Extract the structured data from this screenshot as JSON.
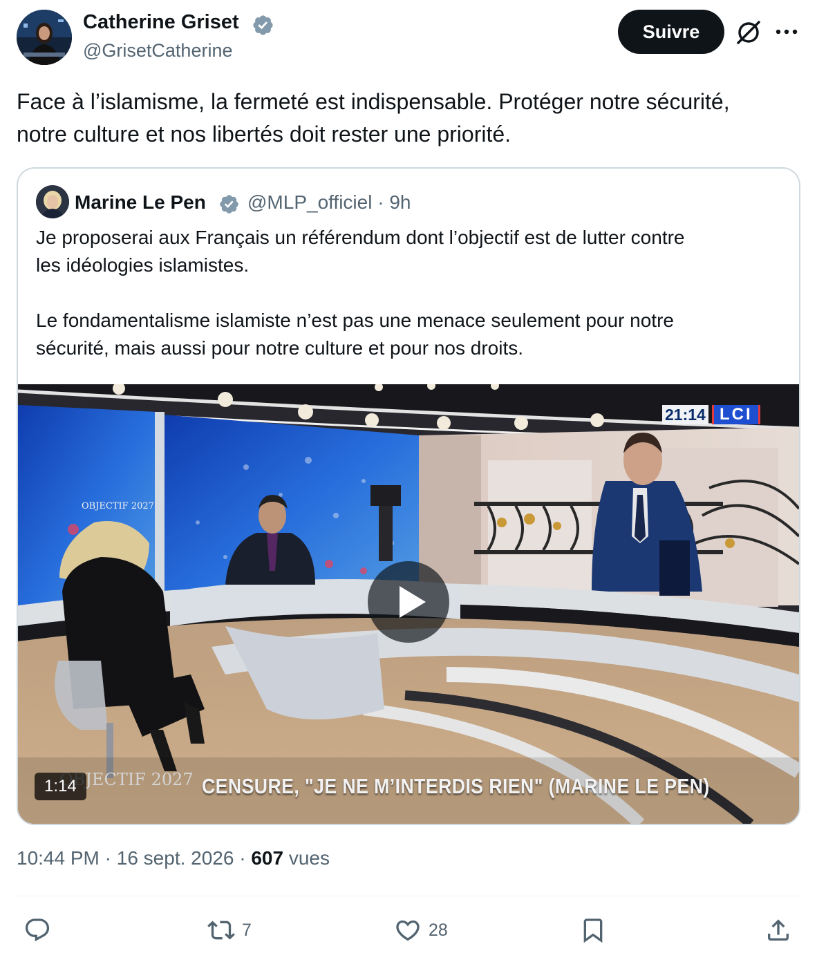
{
  "author": {
    "name": "Catherine Griset",
    "handle": "@GrisetCatherine",
    "verified": true
  },
  "follow_label": "Suivre",
  "icons": {
    "grok": "grok-icon",
    "more": "more-icon",
    "verified": "verified-badge-icon"
  },
  "tweet": {
    "text": "Face à l’islamisme, la fermeté est indispensable. Protéger notre sécurité,\nnotre culture et nos libertés doit rester une priorité."
  },
  "quote": {
    "name": "Marine Le Pen",
    "handle": "@MLP_officiel",
    "time": "9h",
    "text": "Je proposerai aux Français un référendum dont l’objectif est de lutter contre\nles idéologies islamistes.\n\nLe fondamentalisme islamiste n’est pas une menace seulement pour notre\nsécurité, mais aussi pour notre culture et pour nos droits.",
    "video": {
      "duration": "1:14",
      "clock": "21:14",
      "channel": "LCI",
      "chyron": "CENSURE, \"JE NE M’INTERDIS RIEN\" (MARINE LE PEN)",
      "set_logo_word": "OBJECTIF",
      "set_logo_year": "2027"
    }
  },
  "meta": {
    "time": "10:44 PM",
    "sep": "·",
    "date": "16 sept. 2026",
    "views_count": "607",
    "views_label": "vues"
  },
  "actions": {
    "reply_count": "",
    "retweet_count": "7",
    "like_count": "28"
  },
  "colors": {
    "text": "#0f1419",
    "secondary": "#536471",
    "verified": "#829aab",
    "border": "#cfd9de"
  }
}
